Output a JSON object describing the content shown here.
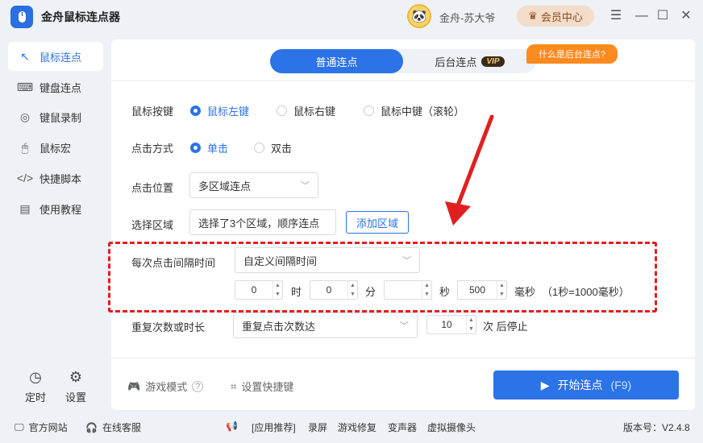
{
  "app": {
    "title": "金舟鼠标连点器",
    "username": "金舟-苏大爷",
    "vip_button": "会员中心",
    "version": "版本号：V2.4.8"
  },
  "sidebar": {
    "items": [
      {
        "label": "鼠标连点"
      },
      {
        "label": "键盘连点"
      },
      {
        "label": "键鼠录制"
      },
      {
        "label": "鼠标宏"
      },
      {
        "label": "快捷脚本"
      },
      {
        "label": "使用教程"
      }
    ],
    "timer": "定时",
    "settings": "设置"
  },
  "tabs": {
    "normal": "普通连点",
    "background": "后台连点",
    "vip_tag": "VIP",
    "tooltip": "什么是后台连点?"
  },
  "form": {
    "mouse_button": {
      "label": "鼠标按键",
      "options": [
        "鼠标左键",
        "鼠标右键",
        "鼠标中键（滚轮）"
      ],
      "selected": "鼠标左键"
    },
    "click_mode": {
      "label": "点击方式",
      "options": [
        "单击",
        "双击"
      ],
      "selected": "单击"
    },
    "click_position": {
      "label": "点击位置",
      "value": "多区域连点"
    },
    "select_area": {
      "label": "选择区域",
      "value": "选择了3个区域，顺序连点",
      "button": "添加区域"
    },
    "interval": {
      "label": "每次点击间隔时间",
      "mode": "自定义间隔时间",
      "hours": "0",
      "hours_unit": "时",
      "minutes": "0",
      "minutes_unit": "分",
      "seconds": "",
      "seconds_unit": "秒",
      "ms": "500",
      "ms_unit": "毫秒",
      "hint": "（1秒=1000毫秒）"
    },
    "repeat": {
      "label": "重复次数或时长",
      "mode": "重复点击次数达",
      "count": "10",
      "suffix": "次 后停止"
    }
  },
  "footer": {
    "game_mode": "游戏模式",
    "hotkey": "设置快捷键",
    "start": "开始连点",
    "start_hotkey": "(F9)"
  },
  "statusbar": {
    "website": "官方网站",
    "support": "在线客服",
    "recommend": "[应用推荐]",
    "links": [
      "录屏",
      "游戏修复",
      "变声器",
      "虚拟摄像头"
    ]
  },
  "colors": {
    "accent": "#2b73e6",
    "highlight_box": "#e02020",
    "tooltip": "#ff8a1e"
  }
}
